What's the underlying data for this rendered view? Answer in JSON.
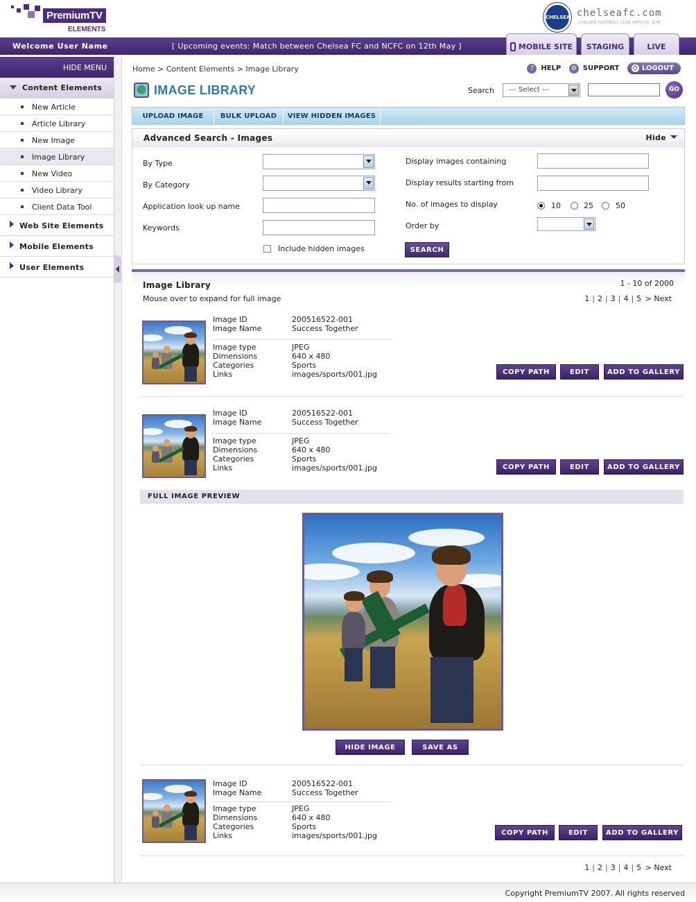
{
  "header": {
    "brand_name": "PremiumTV",
    "brand_sub": "ELEMENTS",
    "club_site": "chelseafc.com",
    "club_tagline": "CHELSEA FOOTBALL CLUB OFFICIAL SITE",
    "club_crest_text": "CHELSEA"
  },
  "topbar": {
    "welcome": "Welcome User Name",
    "events": "[  Upcoming events:  Match between Chelsea FC and NCFC on 12th May  ]",
    "tabs": {
      "mobile": "MOBILE SITE",
      "staging": "STAGING",
      "live": "LIVE"
    }
  },
  "menu": {
    "hide_label": "HIDE MENU",
    "groups": [
      {
        "label": "Content Elements",
        "items": [
          {
            "label": "New Article"
          },
          {
            "label": "Article Library"
          },
          {
            "label": "New Image"
          },
          {
            "label": "Image Library"
          },
          {
            "label": "New Video"
          },
          {
            "label": "Video Library"
          },
          {
            "label": "Client Data Tool"
          }
        ]
      },
      {
        "label": "Web Site Elements"
      },
      {
        "label": "Mobile Elements"
      },
      {
        "label": "User Elements"
      }
    ]
  },
  "breadcrumb": "Home  >  Content Elements  >  Image Library",
  "toplinks": {
    "help": "HELP",
    "support": "SUPPORT",
    "logout": "LOGOUT"
  },
  "title": "IMAGE LIBRARY",
  "search": {
    "label": "Search",
    "select_value": "--- Select ---",
    "go": "GO"
  },
  "actions": {
    "upload": "UPLOAD IMAGE",
    "bulk": "BULK UPLOAD",
    "hidden": "VIEW HIDDEN IMAGES"
  },
  "advanced": {
    "title": "Advanced Search - Images",
    "hide": "Hide",
    "by_type": "By Type",
    "by_category": "By Category",
    "app_lookup": "Application look up name",
    "keywords": "Keywords",
    "include_hidden": "Include hidden images",
    "containing": "Display images containing",
    "starting_from": "Display results starting from",
    "num_images": "No. of images to display",
    "order_by": "Order by",
    "radio": [
      "10",
      "25",
      "50"
    ],
    "search_button": "SEARCH"
  },
  "library": {
    "title": "Image Library",
    "subtitle": "Mouse over to expand for full image",
    "count": "1 - 10 of 2000",
    "pages": [
      "1",
      "2",
      "3",
      "4",
      "5"
    ],
    "next": "> Next",
    "field_labels": {
      "id": "Image ID",
      "name": "Image Name",
      "type": "Image type",
      "dims": "Dimensions",
      "cats": "Categories",
      "links": "Links"
    },
    "items": [
      {
        "id": "200516522-001",
        "name": "Success Together",
        "type": "JPEG",
        "dims": "640 x 480",
        "cats": "Sports",
        "links": "images/sports/001.jpg"
      },
      {
        "id": "200516522-001",
        "name": "Success Together",
        "type": "JPEG",
        "dims": "640 x 480",
        "cats": "Sports",
        "links": "images/sports/001.jpg"
      },
      {
        "id": "200516522-001",
        "name": "Success Together",
        "type": "JPEG",
        "dims": "640 x 480",
        "cats": "Sports",
        "links": "images/sports/001.jpg"
      }
    ],
    "buttons": {
      "copy": "COPY PATH",
      "edit": "EDIT",
      "gallery": "ADD TO GALLERY"
    },
    "preview": {
      "bar": "FULL IMAGE PREVIEW",
      "hide": "HIDE IMAGE",
      "save": "SAVE AS"
    }
  },
  "footer": {
    "copyright": "Copyright PremiumTV 2007. All rights reserved"
  },
  "colors": {
    "brand_purple": "#4b2c7f",
    "title_blue": "#2e7ab0",
    "action_bar_blue": "#a9d4eb"
  }
}
